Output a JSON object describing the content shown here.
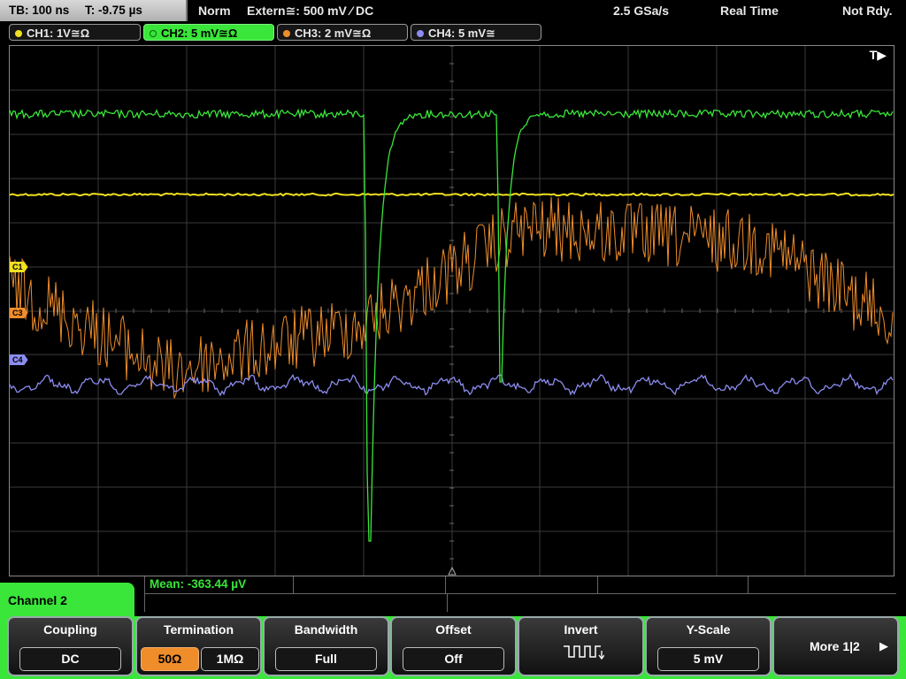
{
  "top": {
    "timebase": "TB: 100 ns",
    "trigger_pos": "T: -9.75 µs",
    "mode": "Norm",
    "trigger": "Extern≅: 500 mV ⁄ DC",
    "sample_rate": "2.5 GSa/s",
    "acq_mode": "Real Time",
    "status": "Not Rdy."
  },
  "channels": [
    {
      "label": "CH1: 1V≅Ω",
      "color": "#f0e020"
    },
    {
      "label": "CH2: 5 mV≅Ω",
      "color": "#39e639"
    },
    {
      "label": "CH3: 2 mV≅Ω",
      "color": "#ef8d2b"
    },
    {
      "label": "CH4: 5 mV≅",
      "color": "#8c8cf0"
    }
  ],
  "markers": {
    "c1": "C1",
    "c3": "C3",
    "c4": "C4",
    "trigger": "T▶"
  },
  "measurement": {
    "mean": "Mean: -363.44 µV"
  },
  "menu": {
    "channel_label": "Channel 2",
    "coupling": {
      "title": "Coupling",
      "value": "DC"
    },
    "termination": {
      "title": "Termination",
      "opt1": "50Ω",
      "opt2": "1MΩ",
      "selected": "50Ω"
    },
    "bandwidth": {
      "title": "Bandwidth",
      "value": "Full"
    },
    "offset": {
      "title": "Offset",
      "value": "Off"
    },
    "invert": {
      "title": "Invert",
      "icon": "invert-waveform-icon"
    },
    "yscale": {
      "title": "Y-Scale",
      "value": "5 mV"
    },
    "more": {
      "label": "More 1|2"
    }
  }
}
